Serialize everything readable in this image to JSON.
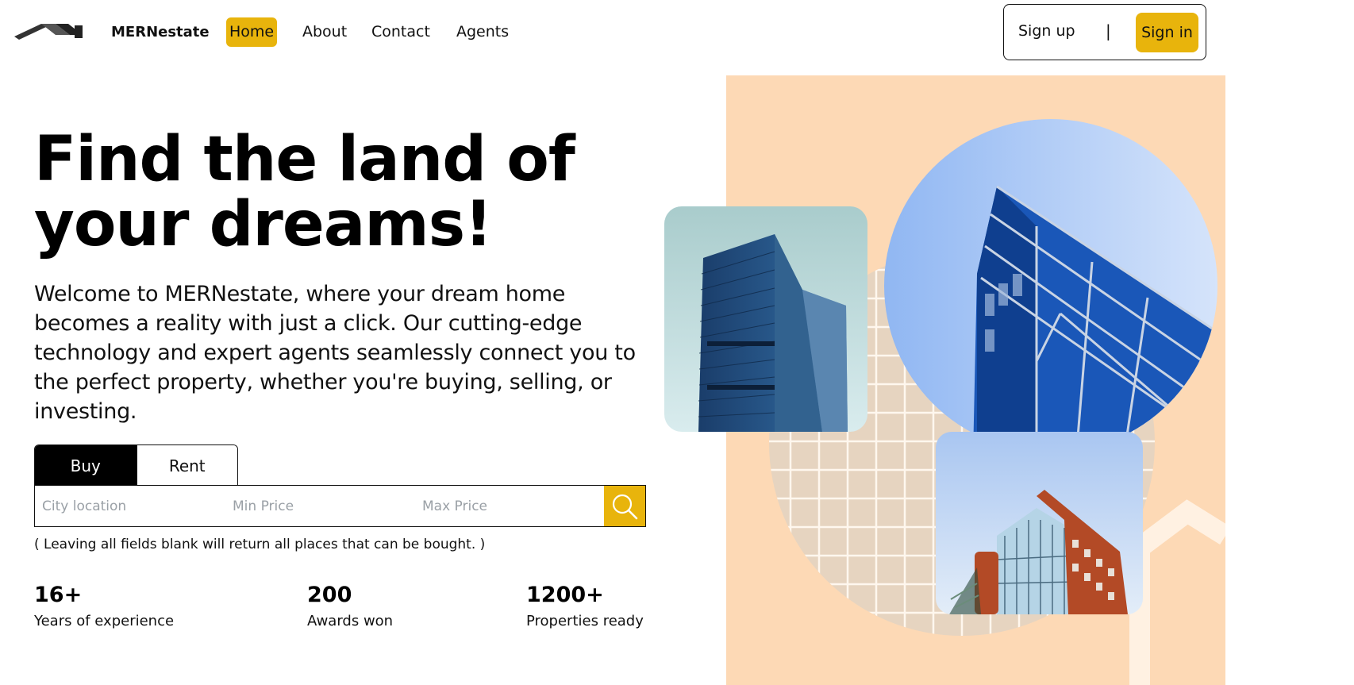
{
  "nav": {
    "brand": "MERNestate",
    "links": [
      {
        "label": "Home",
        "active": true
      },
      {
        "label": "About",
        "active": false
      },
      {
        "label": "Contact",
        "active": false
      },
      {
        "label": "Agents",
        "active": false
      }
    ],
    "sign_up": "Sign up",
    "separator": "|",
    "sign_in": "Sign in"
  },
  "hero": {
    "title_line1": "Find the land of",
    "title_line2": "your dreams!",
    "description": "Welcome to MERNestate, where your dream home becomes a reality with just a click. Our cutting-edge technology and expert agents seamlessly connect you to the perfect property, whether you're buying, selling, or investing."
  },
  "search": {
    "tabs": [
      {
        "label": "Buy",
        "active": true
      },
      {
        "label": "Rent",
        "active": false
      }
    ],
    "city_placeholder": "City location",
    "min_placeholder": "Min Price",
    "max_placeholder": "Max Price",
    "search_icon": "search-icon",
    "hint": "( Leaving all fields blank will return all places that can be bought. )"
  },
  "stats": [
    {
      "value": "16+",
      "label": "Years of experience"
    },
    {
      "value": "200",
      "label": "Awards won"
    },
    {
      "value": "1200+",
      "label": "Properties ready"
    }
  ],
  "colors": {
    "accent": "#e8b40c",
    "art_background": "#fdd9b5",
    "grid_circle": "#e6d4c0",
    "building_blue": "#1f4f8f"
  }
}
